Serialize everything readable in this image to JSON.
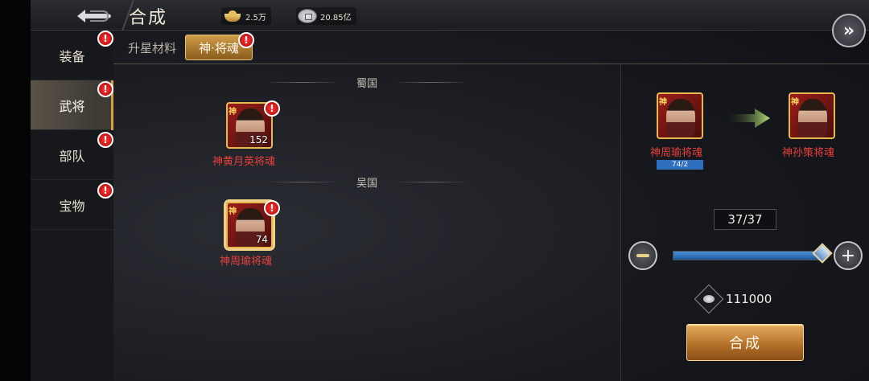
{
  "header": {
    "title": "合成",
    "gold_ingot": "2.5万",
    "silver_coin": "20.85亿",
    "back_icon": "back-arrow-icon",
    "forward_icon": "double-chevron-right-icon"
  },
  "sidebar": {
    "items": [
      {
        "label": "装备",
        "alert": "!",
        "active": false
      },
      {
        "label": "武将",
        "alert": "!",
        "active": true
      },
      {
        "label": "部队",
        "alert": "!",
        "active": false
      },
      {
        "label": "宝物",
        "alert": "!",
        "active": false
      }
    ]
  },
  "tabs": [
    {
      "label": "升星材料",
      "active": false
    },
    {
      "label": "神·将魂",
      "active": true,
      "alert": "!"
    }
  ],
  "groups": [
    {
      "title": "蜀国",
      "cards": [
        {
          "name": "神黄月英将魂",
          "count": "152",
          "mark": "神",
          "alert": "!"
        }
      ]
    },
    {
      "title": "吴国",
      "cards": [
        {
          "name": "神周瑜将魂",
          "count": "74",
          "mark": "神",
          "alert": "!"
        }
      ]
    }
  ],
  "compose": {
    "source_name": "神周瑜将魂",
    "source_mark": "神",
    "source_progress": "74/2",
    "target_name": "神孙策将魂",
    "target_mark": "神",
    "quantity": "37/37",
    "slider_fraction": 1.0,
    "cost_icon": "silver-coin-icon",
    "cost": "111000",
    "button_label": "合成"
  },
  "colors": {
    "accent_gold": "#d8a042",
    "alert_red": "#d00000",
    "name_red": "#e8403c",
    "progress_blue": "#2f6fc0"
  }
}
